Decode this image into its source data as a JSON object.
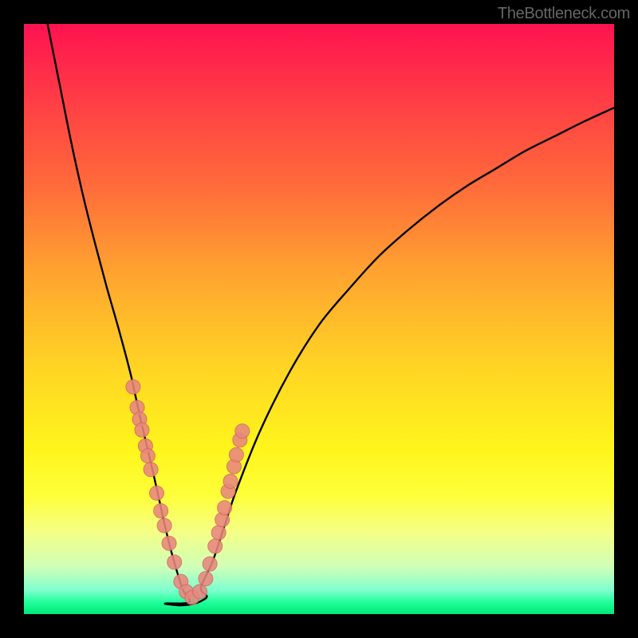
{
  "watermark": "TheBottleneck.com",
  "chart_data": {
    "type": "line",
    "title": "",
    "xlabel": "",
    "ylabel": "",
    "xlim": [
      0,
      100
    ],
    "ylim": [
      0,
      100
    ],
    "curve_left": {
      "name": "left-branch",
      "x": [
        4,
        6,
        8,
        10,
        12,
        14,
        16,
        18,
        19,
        20,
        21,
        22,
        23,
        24,
        25,
        26,
        27,
        28
      ],
      "y": [
        100,
        90,
        80,
        71,
        63,
        55.5,
        48.5,
        41,
        36.5,
        32,
        27.8,
        23.5,
        19,
        14.5,
        10.5,
        7,
        4,
        2
      ]
    },
    "curve_right": {
      "name": "right-branch",
      "x": [
        28,
        30,
        32,
        34,
        36,
        40,
        45,
        50,
        55,
        60,
        65,
        70,
        75,
        80,
        85,
        90,
        95,
        100
      ],
      "y": [
        2,
        4.5,
        9,
        15,
        21,
        31,
        41,
        49,
        55,
        60.5,
        65,
        69,
        72.5,
        75.5,
        78.5,
        81,
        83.5,
        85.8
      ]
    },
    "flat_bottom": {
      "x": [
        23,
        24,
        25,
        26,
        27,
        28,
        29,
        30,
        31
      ],
      "y": [
        2.2,
        1.8,
        1.6,
        1.5,
        1.5,
        1.6,
        1.8,
        2.2,
        3.0
      ]
    },
    "dots_left": {
      "name": "left-cluster",
      "x": [
        18.5,
        19.2,
        19.6,
        20.0,
        20.6,
        21.0,
        21.5,
        22.5,
        23.2,
        23.8,
        24.6,
        25.5,
        26.6,
        27.5,
        28.5
      ],
      "y": [
        38.5,
        35.0,
        33.0,
        31.2,
        28.5,
        26.8,
        24.5,
        20.5,
        17.5,
        15.0,
        12.0,
        8.8,
        5.5,
        3.8,
        2.8
      ]
    },
    "dots_right": {
      "name": "right-cluster",
      "x": [
        29.8,
        30.8,
        31.5,
        32.4,
        33.0,
        33.6,
        34.0,
        34.6,
        35.0,
        35.6,
        36.0,
        36.6,
        37.0
      ],
      "y": [
        3.8,
        6.0,
        8.5,
        11.5,
        13.8,
        16.0,
        18.0,
        20.8,
        22.5,
        25.0,
        27.0,
        29.5,
        31.0
      ]
    },
    "dot_color": "#e8877f",
    "dot_stroke": "#d4685f",
    "curve_color": "#000000"
  }
}
